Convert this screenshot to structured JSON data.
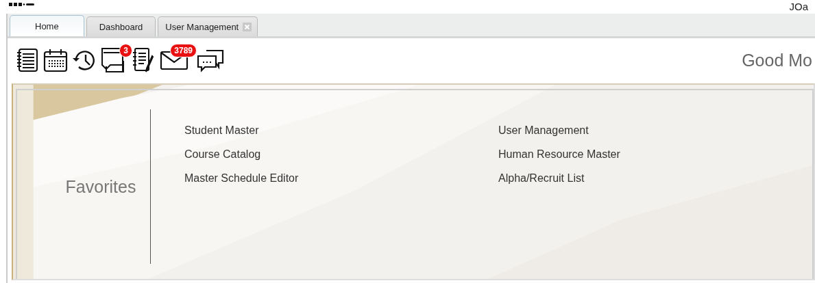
{
  "header": {
    "user": "JOa"
  },
  "tabs": [
    {
      "label": "Home",
      "selected": true,
      "closable": false
    },
    {
      "label": "Dashboard",
      "selected": false,
      "closable": false
    },
    {
      "label": "User Management",
      "selected": false,
      "closable": true
    }
  ],
  "toolbar": [
    {
      "kind": "notebook"
    },
    {
      "kind": "calendar"
    },
    {
      "kind": "history"
    },
    {
      "kind": "notes",
      "badge": "3"
    },
    {
      "kind": "notepad"
    },
    {
      "kind": "mail",
      "badge": "3789"
    },
    {
      "kind": "chat"
    }
  ],
  "greeting": "Good Mo",
  "favorites": {
    "title": "Favorites",
    "columns": [
      [
        "Student Master",
        "Course Catalog",
        "Master Schedule Editor"
      ],
      [
        "User Management",
        "Human Resource Master",
        "Alpha/Recruit List"
      ]
    ]
  }
}
